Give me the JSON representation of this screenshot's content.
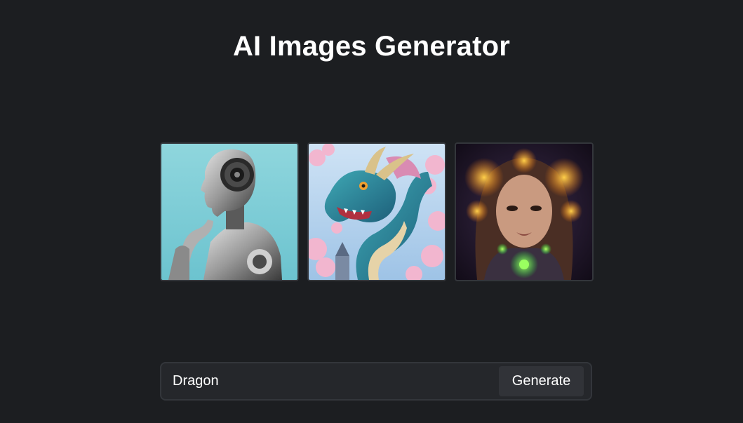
{
  "header": {
    "title": "AI Images Generator"
  },
  "gallery": {
    "images": [
      {
        "name": "robot-thinking-image",
        "subject": "robot-profile"
      },
      {
        "name": "dragon-blossom-image",
        "subject": "dragon"
      },
      {
        "name": "cyber-girl-image",
        "subject": "cyber-woman"
      }
    ]
  },
  "prompt": {
    "value": "Dragon",
    "placeholder": "",
    "generate_label": "Generate"
  },
  "colors": {
    "background": "#1c1e21",
    "panel": "#25272b",
    "border": "#33363b",
    "button": "#313338",
    "text": "#ffffff"
  }
}
